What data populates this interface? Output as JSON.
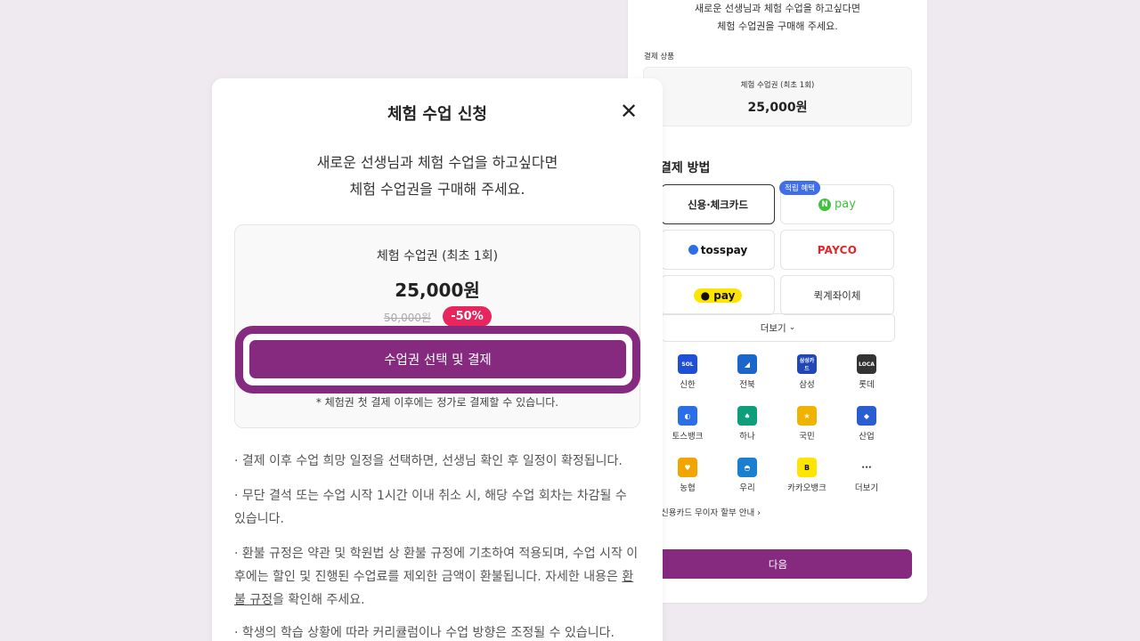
{
  "back_panel": {
    "intro_line1": "새로운 선생님과 체험 수업을 하고싶다면",
    "intro_line2": "체험 수업권을 구매해 주세요.",
    "product_section_label": "결제 상품",
    "product_name": "체험 수업권 (최초 1회)",
    "product_price": "25,000원",
    "payment_method_title": "결제 방법",
    "methods": {
      "card": "신용·체크카드",
      "npay_badge": "적립 혜택",
      "npay_n": "N",
      "npay": "pay",
      "tosspay": "tosspay",
      "payco": "PAYCO",
      "kakaopay": "pay",
      "transfer": "퀵계좌이체"
    },
    "more_label": "더보기",
    "banks": [
      {
        "label": "신한",
        "icon": "shinhan-icon",
        "color": "#1e4fd6",
        "glyph": "SOL"
      },
      {
        "label": "전북",
        "icon": "jeonbuk-icon",
        "color": "#1a66c9",
        "glyph": "◢"
      },
      {
        "label": "삼성",
        "icon": "samsung-icon",
        "color": "#1f47b8",
        "glyph": "삼성카드"
      },
      {
        "label": "롯데",
        "icon": "lotte-icon",
        "color": "#333333",
        "glyph": "LOCA"
      },
      {
        "label": "토스뱅크",
        "icon": "tossbank-icon",
        "color": "#2a6fe8",
        "glyph": "◐"
      },
      {
        "label": "하나",
        "icon": "hana-icon",
        "color": "#0d9e7a",
        "glyph": "♠"
      },
      {
        "label": "국민",
        "icon": "kb-icon",
        "color": "#f0b400",
        "glyph": "★"
      },
      {
        "label": "산업",
        "icon": "kdb-icon",
        "color": "#2a5dd1",
        "glyph": "◆"
      },
      {
        "label": "농협",
        "icon": "nh-icon",
        "color": "#f2a400",
        "glyph": "♥"
      },
      {
        "label": "우리",
        "icon": "woori-icon",
        "color": "#1a7fd1",
        "glyph": "◓"
      },
      {
        "label": "카카오뱅크",
        "icon": "kakaobank-icon",
        "color": "#fee500",
        "glyph": "B"
      },
      {
        "label": "더보기",
        "icon": "more-dots-icon",
        "color": "#ffffff",
        "glyph": "•••"
      }
    ],
    "installment": "신용카드 무이자 할부 안내",
    "next_button": "다음"
  },
  "modal": {
    "title": "체험 수업 신청",
    "close_glyph": "✕",
    "subtitle_line1": "새로운 선생님과 체험 수업을 하고싶다면",
    "subtitle_line2": "체험 수업권을 구매해 주세요.",
    "product_name": "체험 수업권 (최초 1회)",
    "price": "25,000원",
    "original_price": "50,000원",
    "discount": "-50%",
    "pay_button": "수업권 선택 및 결제",
    "note": "* 체험권 첫 결제 이후에는 정가로 결제할 수 있습니다.",
    "notices": [
      "· 결제 이후 수업 희망 일정을 선택하면, 선생님 확인 후 일정이 확정됩니다.",
      "· 무단 결석 또는 수업 시작 1시간 이내 취소 시, 해당 수업 회차는 차감될 수 있습니다.",
      "· 환불 규정은 약관 및 학원법 상 환불 규정에 기초하여 적용되며, 수업 시작 이후에는 할인 및 진행된 수업료를 제외한 금액이 환불됩니다. 자세한 내용은 ",
      "환불 규정",
      "을 확인해 주세요.",
      "· 학생의 학습 상황에 따라 커리큘럼이나 수업 방향은 조정될 수 있습니다."
    ]
  },
  "colors": {
    "accent": "#862a80",
    "discount": "#e8255c",
    "npay_green": "#3ec33e"
  }
}
